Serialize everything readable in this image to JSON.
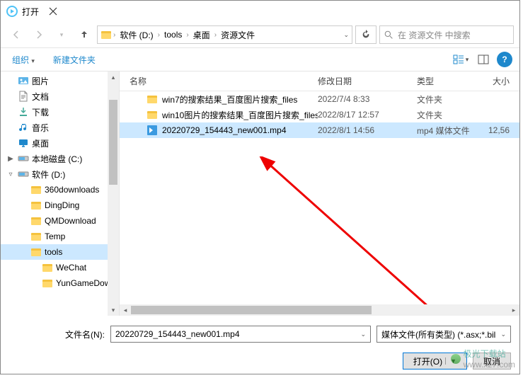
{
  "title": "打开",
  "breadcrumb": [
    "软件 (D:)",
    "tools",
    "桌面",
    "资源文件"
  ],
  "search_placeholder": "在 资源文件 中搜索",
  "toolbar": {
    "organize": "组织",
    "new_folder": "新建文件夹"
  },
  "sidebar": {
    "items": [
      {
        "icon": "pictures",
        "label": "图片",
        "indent": 0
      },
      {
        "icon": "documents",
        "label": "文档",
        "indent": 0
      },
      {
        "icon": "downloads",
        "label": "下载",
        "indent": 0
      },
      {
        "icon": "music",
        "label": "音乐",
        "indent": 0
      },
      {
        "icon": "desktop",
        "label": "桌面",
        "indent": 0
      },
      {
        "icon": "drive-c",
        "label": "本地磁盘 (C:)",
        "indent": 0,
        "chevron": "▶"
      },
      {
        "icon": "drive-d",
        "label": "软件 (D:)",
        "indent": 0,
        "chevron": "▿"
      },
      {
        "icon": "folder",
        "label": "360downloads",
        "indent": 1
      },
      {
        "icon": "folder",
        "label": "DingDing",
        "indent": 1
      },
      {
        "icon": "folder",
        "label": "QMDownload",
        "indent": 1
      },
      {
        "icon": "folder",
        "label": "Temp",
        "indent": 1
      },
      {
        "icon": "folder",
        "label": "tools",
        "indent": 1,
        "selected": true
      },
      {
        "icon": "folder",
        "label": "WeChat",
        "indent": 2
      },
      {
        "icon": "folder",
        "label": "YunGameDown",
        "indent": 2
      }
    ]
  },
  "columns": {
    "name": "名称",
    "date": "修改日期",
    "type": "类型",
    "size": "大小"
  },
  "files": [
    {
      "icon": "folder",
      "name": "win7的搜索结果_百度图片搜索_files",
      "date": "2022/7/4 8:33",
      "type": "文件夹",
      "size": ""
    },
    {
      "icon": "folder",
      "name": "win10图片的搜索结果_百度图片搜索_files",
      "date": "2022/8/17 12:57",
      "type": "文件夹",
      "size": ""
    },
    {
      "icon": "mp4",
      "name": "20220729_154443_new001.mp4",
      "date": "2022/8/1 14:56",
      "type": "mp4 媒体文件",
      "size": "12,56",
      "selected": true
    }
  ],
  "filename_label": "文件名(N):",
  "filename_value": "20220729_154443_new001.mp4",
  "filetype_value": "媒体文件(所有类型) (*.asx;*.bil",
  "open_btn": "打开(O)",
  "cancel_btn": "取消",
  "watermark": {
    "text": "极光下载站",
    "url": "www.xz7.com"
  }
}
